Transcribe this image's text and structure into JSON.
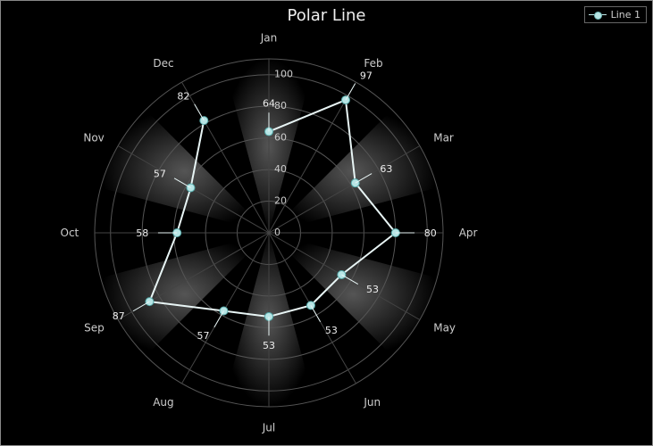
{
  "chart_data": {
    "type": "radar",
    "title": "Polar Line",
    "categories": [
      "Jan",
      "Feb",
      "Mar",
      "Apr",
      "May",
      "Jun",
      "Jul",
      "Aug",
      "Sep",
      "Oct",
      "Nov",
      "Dec"
    ],
    "series": [
      {
        "name": "Line 1",
        "values": [
          64,
          97,
          63,
          80,
          53,
          53,
          53,
          57,
          87,
          58,
          57,
          82
        ]
      }
    ],
    "radial_ticks": [
      0,
      20,
      40,
      60,
      80,
      100
    ],
    "rlim": [
      0,
      110
    ],
    "legend_position": "top-right",
    "angle_start_deg": -90,
    "angle_direction": "clockwise"
  }
}
